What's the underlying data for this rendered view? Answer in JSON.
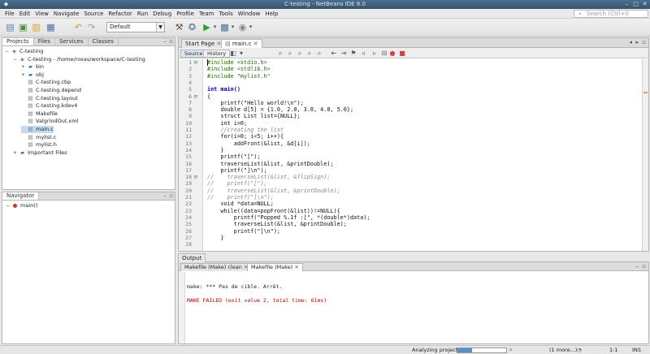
{
  "window": {
    "title": "C-testing - NetBeans IDE 8.0"
  },
  "menu": [
    "File",
    "Edit",
    "View",
    "Navigate",
    "Source",
    "Refactor",
    "Run",
    "Debug",
    "Profile",
    "Team",
    "Tools",
    "Window",
    "Help"
  ],
  "search": {
    "placeholder": "Search (Ctrl+I)"
  },
  "toolbar": {
    "config_value": "Default"
  },
  "projects": {
    "tabs": [
      "Projects",
      "Files",
      "Services",
      "Classes"
    ],
    "tree": [
      {
        "label": "C-testing",
        "indent": 0,
        "icon": "project",
        "toggle": "−"
      },
      {
        "label": "C-testing - /home/roxas/workspace/C-testing",
        "indent": 1,
        "icon": "project",
        "toggle": "−"
      },
      {
        "label": "bin",
        "indent": 2,
        "icon": "folder",
        "toggle": "+"
      },
      {
        "label": "obj",
        "indent": 2,
        "icon": "folder",
        "toggle": "+"
      },
      {
        "label": "C-testing.cbp",
        "indent": 2,
        "icon": "file",
        "toggle": ""
      },
      {
        "label": "C-testing.depend",
        "indent": 2,
        "icon": "file",
        "toggle": ""
      },
      {
        "label": "C-testing.layout",
        "indent": 2,
        "icon": "file",
        "toggle": ""
      },
      {
        "label": "C-testing.kdev4",
        "indent": 2,
        "icon": "file",
        "toggle": ""
      },
      {
        "label": "Makefile",
        "indent": 2,
        "icon": "file",
        "toggle": ""
      },
      {
        "label": "ValgrindOut.xml",
        "indent": 2,
        "icon": "file",
        "toggle": ""
      },
      {
        "label": "main.c",
        "indent": 2,
        "icon": "file",
        "toggle": "",
        "selected": true
      },
      {
        "label": "mylist.c",
        "indent": 2,
        "icon": "file",
        "toggle": ""
      },
      {
        "label": "mylist.h",
        "indent": 2,
        "icon": "file",
        "toggle": ""
      },
      {
        "label": "Important Files",
        "indent": 1,
        "icon": "folder",
        "toggle": "+"
      }
    ]
  },
  "navigator": {
    "title": "Navigator",
    "item": "main()"
  },
  "editor": {
    "tabs": [
      "Start Page",
      "main.c"
    ],
    "source_label": "Source",
    "history_label": "History",
    "line_numbers": [
      "1",
      "2",
      "3",
      "4",
      "5",
      "6",
      "7",
      "8",
      "9",
      "10",
      "11",
      "12",
      "13",
      "14",
      "15",
      "16",
      "17",
      "18",
      "19",
      "20",
      "21",
      "22",
      "23",
      "24",
      "25",
      "26",
      "27",
      "28"
    ],
    "lines": [
      {
        "t": "#include <stdio.h>",
        "c": "inc"
      },
      {
        "t": "#include <stdlib.h>",
        "c": "inc"
      },
      {
        "t": "#include \"mylist.h\"",
        "c": "inc"
      },
      {
        "t": "",
        "c": ""
      },
      {
        "t": "int main()",
        "c": "kw"
      },
      {
        "t": "{",
        "c": ""
      },
      {
        "t": "    printf(\"Hello world!\\n\");",
        "c": ""
      },
      {
        "t": "    double d[5] = {1.0, 2.0, 3.0, 4.0, 5.0};",
        "c": ""
      },
      {
        "t": "    struct List list={NULL};",
        "c": ""
      },
      {
        "t": "    int i=0;",
        "c": ""
      },
      {
        "t": "    //creating the list",
        "c": "cmt"
      },
      {
        "t": "    for(i=0; i<5; i++){",
        "c": ""
      },
      {
        "t": "        addFront(&list, &d[i]);",
        "c": ""
      },
      {
        "t": "    }",
        "c": ""
      },
      {
        "t": "    printf(\"[\");",
        "c": ""
      },
      {
        "t": "    traverseList(&list, &printDouble);",
        "c": ""
      },
      {
        "t": "    printf(\"]\\n\");",
        "c": ""
      },
      {
        "t": "//    traverseList(&list, &flipSign);",
        "c": "cmt"
      },
      {
        "t": "//    printf(\"[\");",
        "c": "cmt"
      },
      {
        "t": "//    traverseList(&list, &printDouble);",
        "c": "cmt"
      },
      {
        "t": "//    printf(\"]\\n\");",
        "c": "cmt"
      },
      {
        "t": "    void *data=NULL;",
        "c": ""
      },
      {
        "t": "    while((data=popFront(&list))!=NULL){",
        "c": ""
      },
      {
        "t": "        printf(\"Popped %.1f :[\", *(double*)data);",
        "c": ""
      },
      {
        "t": "        traverseList(&list, &printDouble);",
        "c": ""
      },
      {
        "t": "        printf(\"]\\n\");",
        "c": ""
      },
      {
        "t": "    }",
        "c": ""
      },
      {
        "t": "",
        "c": ""
      }
    ]
  },
  "output": {
    "title": "Output",
    "tabs": [
      "Makefile (Make) clean",
      "Makefile (Make)"
    ],
    "lines": [
      {
        "t": "make: *** Pas de cible. Arrêt.",
        "err": false
      },
      {
        "t": "",
        "err": false
      },
      {
        "t": "MAKE FAILED (exit value 2, total time: 61ms)",
        "err": true
      }
    ]
  },
  "status": {
    "analyzing": "Analyzing project...",
    "more": "(1 more...)",
    "position": "1:1",
    "mode": "INS",
    "progress": 0.3
  }
}
